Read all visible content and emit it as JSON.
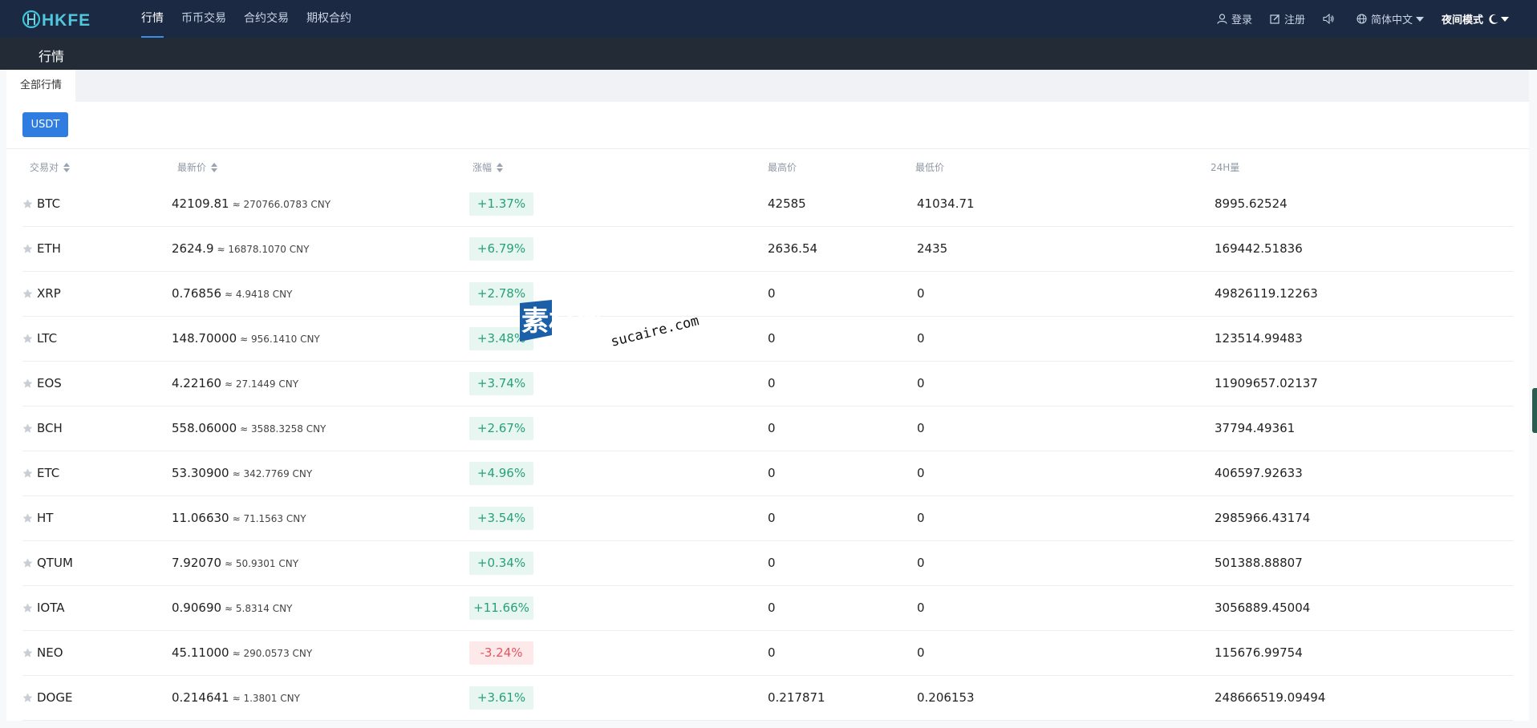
{
  "app": {
    "brand": "HKFE"
  },
  "nav": {
    "links": [
      "行情",
      "币币交易",
      "合约交易",
      "期权合约"
    ],
    "active_index": 0,
    "login": "登录",
    "register": "注册",
    "language": "简体中文",
    "night_mode": "夜间模式"
  },
  "page": {
    "title": "行情"
  },
  "tabs": {
    "all": "全部行情"
  },
  "filters": {
    "quote": "USDT"
  },
  "table": {
    "headers": {
      "pair": "交易对",
      "price": "最新价",
      "change": "涨幅",
      "high": "最高价",
      "low": "最低价",
      "volume": "24H量"
    },
    "rows": [
      {
        "pair": "BTC",
        "price": "42109.81",
        "cny": "≈ 270766.0783 CNY",
        "change": "+1.37%",
        "high": "42585",
        "low": "41034.71",
        "volume": "8995.62524",
        "trend": "up"
      },
      {
        "pair": "ETH",
        "price": "2624.9",
        "cny": "≈ 16878.1070 CNY",
        "change": "+6.79%",
        "high": "2636.54",
        "low": "2435",
        "volume": "169442.51836",
        "trend": "up"
      },
      {
        "pair": "XRP",
        "price": "0.76856",
        "cny": "≈ 4.9418 CNY",
        "change": "+2.78%",
        "high": "0",
        "low": "0",
        "volume": "49826119.12263",
        "trend": "up"
      },
      {
        "pair": "LTC",
        "price": "148.70000",
        "cny": "≈ 956.1410 CNY",
        "change": "+3.48%",
        "high": "0",
        "low": "0",
        "volume": "123514.99483",
        "trend": "up"
      },
      {
        "pair": "EOS",
        "price": "4.22160",
        "cny": "≈ 27.1449 CNY",
        "change": "+3.74%",
        "high": "0",
        "low": "0",
        "volume": "11909657.02137",
        "trend": "up"
      },
      {
        "pair": "BCH",
        "price": "558.06000",
        "cny": "≈ 3588.3258 CNY",
        "change": "+2.67%",
        "high": "0",
        "low": "0",
        "volume": "37794.49361",
        "trend": "up"
      },
      {
        "pair": "ETC",
        "price": "53.30900",
        "cny": "≈ 342.7769 CNY",
        "change": "+4.96%",
        "high": "0",
        "low": "0",
        "volume": "406597.92633",
        "trend": "up"
      },
      {
        "pair": "HT",
        "price": "11.06630",
        "cny": "≈ 71.1563 CNY",
        "change": "+3.54%",
        "high": "0",
        "low": "0",
        "volume": "2985966.43174",
        "trend": "up"
      },
      {
        "pair": "QTUM",
        "price": "7.92070",
        "cny": "≈ 50.9301 CNY",
        "change": "+0.34%",
        "high": "0",
        "low": "0",
        "volume": "501388.88807",
        "trend": "up"
      },
      {
        "pair": "IOTA",
        "price": "0.90690",
        "cny": "≈ 5.8314 CNY",
        "change": "+11.66%",
        "high": "0",
        "low": "0",
        "volume": "3056889.45004",
        "trend": "up"
      },
      {
        "pair": "NEO",
        "price": "45.11000",
        "cny": "≈ 290.0573 CNY",
        "change": "-3.24%",
        "high": "0",
        "low": "0",
        "volume": "115676.99754",
        "trend": "down"
      },
      {
        "pair": "DOGE",
        "price": "0.214641",
        "cny": "≈ 1.3801 CNY",
        "change": "+3.61%",
        "high": "0.217871",
        "low": "0.206153",
        "volume": "248666519.09494",
        "trend": "up"
      }
    ]
  },
  "watermark": {
    "cn": "素材熱",
    "url": "sucaire.com"
  },
  "colors": {
    "nav_bg": "#1b2942",
    "accent": "#2f7de1",
    "up": "#27a17a",
    "down": "#e2555c"
  }
}
